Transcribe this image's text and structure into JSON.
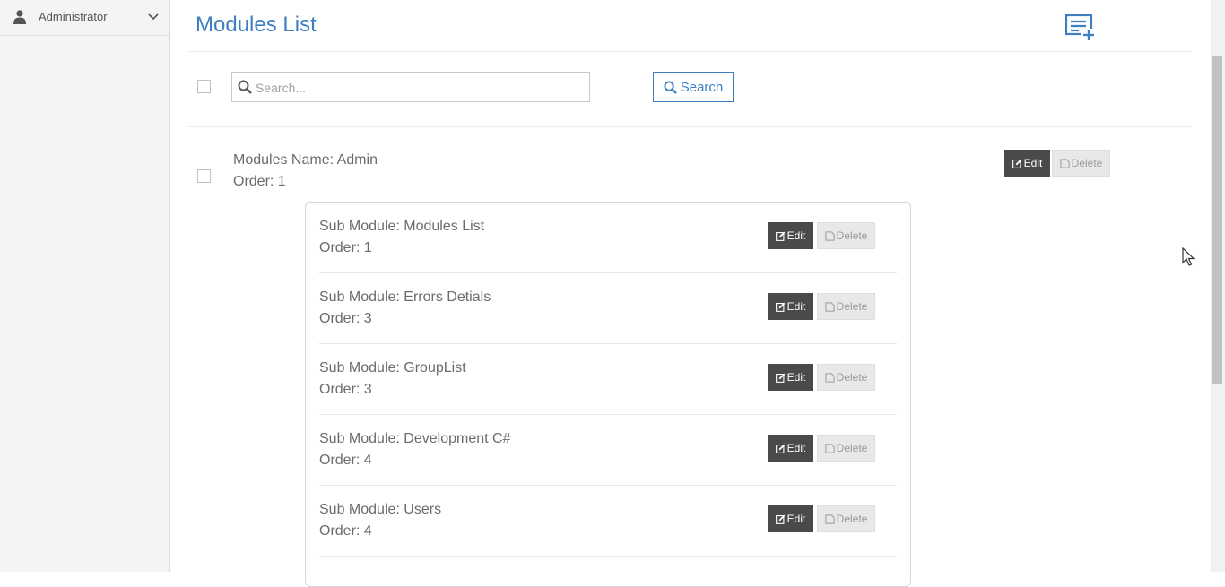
{
  "sidebar": {
    "user_name": "Administrator",
    "user_icon": "user-icon",
    "toggle_icon": "chevron-down-icon"
  },
  "header": {
    "title": "Modules List",
    "add_icon": "playlist-add-icon"
  },
  "search": {
    "placeholder": "Search...",
    "value": "",
    "button_label": "Search"
  },
  "module": {
    "name": "Modules Name: Admin",
    "order": "Order: 1",
    "edit_label": "Edit",
    "delete_label": "Delete"
  },
  "sub_modules": [
    {
      "name": "Sub Module: Modules List",
      "order": "Order: 1",
      "edit_label": "Edit",
      "delete_label": "Delete"
    },
    {
      "name": "Sub Module: Errors Detials",
      "order": "Order: 3",
      "edit_label": "Edit",
      "delete_label": "Delete"
    },
    {
      "name": "Sub Module: GroupList",
      "order": "Order: 3",
      "edit_label": "Edit",
      "delete_label": "Delete"
    },
    {
      "name": "Sub Module: Development C#",
      "order": "Order: 4",
      "edit_label": "Edit",
      "delete_label": "Delete"
    },
    {
      "name": "Sub Module: Users",
      "order": "Order: 4",
      "edit_label": "Edit",
      "delete_label": "Delete"
    }
  ],
  "colors": {
    "accent": "#3d7fc2",
    "edit_bg": "#4a4a4a",
    "delete_bg": "#e8e8e8",
    "sidebar_bg": "#f4f4f4"
  }
}
